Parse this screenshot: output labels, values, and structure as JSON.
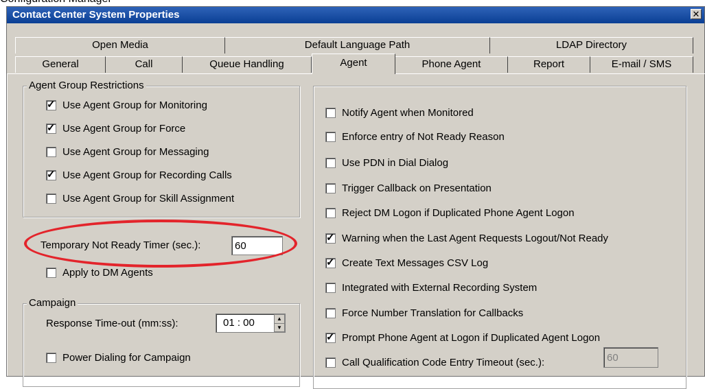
{
  "background_caption": "Configuration Manager",
  "dialog": {
    "title": "Contact Center System Properties",
    "close_icon": "close-icon"
  },
  "tabs": {
    "row1": [
      "Open Media",
      "Default Language Path",
      "LDAP Directory"
    ],
    "row2": [
      "General",
      "Call",
      "Queue Handling",
      "Agent",
      "Phone Agent",
      "Report",
      "E-mail / SMS"
    ],
    "active": "Agent"
  },
  "agent_group_restrictions": {
    "legend": "Agent Group Restrictions",
    "items": [
      {
        "label": "Use Agent Group for Monitoring",
        "checked": true
      },
      {
        "label": "Use Agent Group for Force",
        "checked": true
      },
      {
        "label": "Use Agent Group for Messaging",
        "checked": false
      },
      {
        "label": "Use Agent Group for Recording Calls",
        "checked": true
      },
      {
        "label": "Use Agent Group for Skill Assignment",
        "checked": false
      }
    ]
  },
  "temp_not_ready": {
    "label": "Temporary Not Ready Timer (sec.):",
    "value": "60",
    "apply_label": "Apply to DM Agents",
    "apply_checked": false
  },
  "campaign": {
    "legend": "Campaign",
    "response_label": "Response Time-out (mm:ss):",
    "response_value": "01 : 00",
    "power_dialing_label": "Power Dialing for Campaign",
    "power_dialing_checked": false
  },
  "right_options": [
    {
      "label": "Notify Agent when Monitored",
      "checked": false
    },
    {
      "label": "Enforce entry of Not Ready Reason",
      "checked": false
    },
    {
      "label": "Use PDN in Dial Dialog",
      "checked": false
    },
    {
      "label": "Trigger Callback on Presentation",
      "checked": false
    },
    {
      "label": "Reject DM Logon if Duplicated Phone Agent Logon",
      "checked": false
    },
    {
      "label": "Warning when the Last Agent Requests Logout/Not Ready",
      "checked": true
    },
    {
      "label": "Create Text Messages CSV Log",
      "checked": true
    },
    {
      "label": "Integrated with External Recording System",
      "checked": false
    },
    {
      "label": "Force Number Translation for Callbacks",
      "checked": false
    },
    {
      "label": "Prompt Phone Agent at Logon if Duplicated Agent Logon",
      "checked": true
    },
    {
      "label": "Call Qualification Code Entry Timeout (sec.):",
      "checked": false
    }
  ],
  "call_qualification_timeout_value": "60",
  "annotation_color": "#e3242b"
}
